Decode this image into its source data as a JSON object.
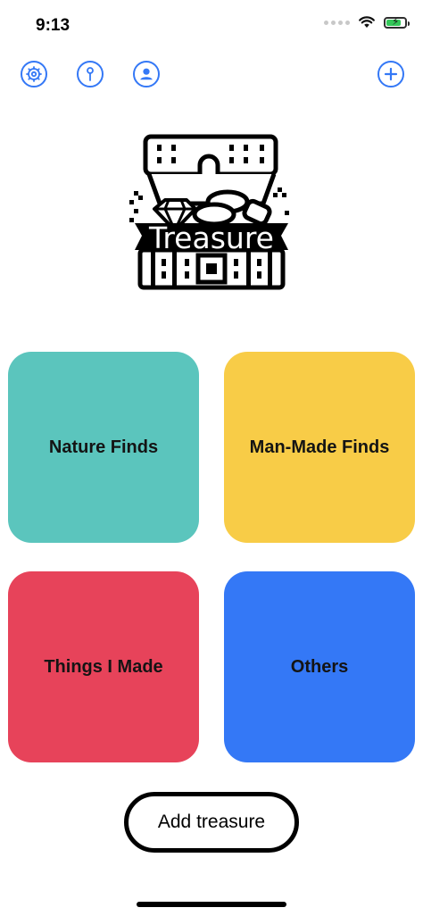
{
  "status_bar": {
    "time": "9:13",
    "battery_level": 0.8
  },
  "toolbar": {
    "left_icons": [
      "settings-icon",
      "pin-icon",
      "profile-icon"
    ],
    "right_icon": "add-icon",
    "accent_color": "#3478f6"
  },
  "logo": {
    "text": "Treasure",
    "icon": "treasure-chest-icon"
  },
  "categories": [
    {
      "label": "Nature Finds",
      "color": "#5bc5bd"
    },
    {
      "label": "Man-Made Finds",
      "color": "#f8cc47"
    },
    {
      "label": "Things I Made",
      "color": "#e7435a"
    },
    {
      "label": "Others",
      "color": "#3478f6"
    }
  ],
  "actions": {
    "add_treasure_label": "Add treasure"
  }
}
